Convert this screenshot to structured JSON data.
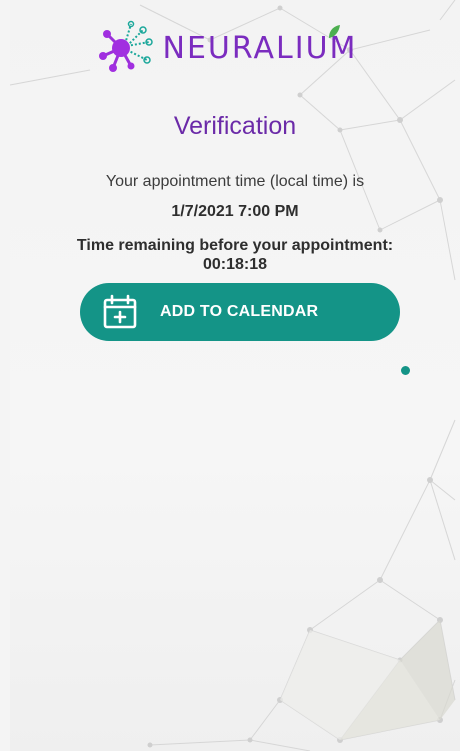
{
  "app": {
    "brand_name": "NEURALIUM",
    "brand_color": "#7b2cbf",
    "accent_color": "#149487"
  },
  "icons": {
    "logo": "neural-network-logo-icon",
    "calendar": "calendar-add-icon"
  },
  "verification": {
    "title": "Verification",
    "appointment_intro": "Your appointment time (local time) is",
    "appointment_datetime": "1/7/2021 7:00 PM",
    "remaining_label": "Time remaining before your appointment:",
    "remaining_value": "00:18:18",
    "add_to_calendar_label": "ADD TO CALENDAR"
  }
}
